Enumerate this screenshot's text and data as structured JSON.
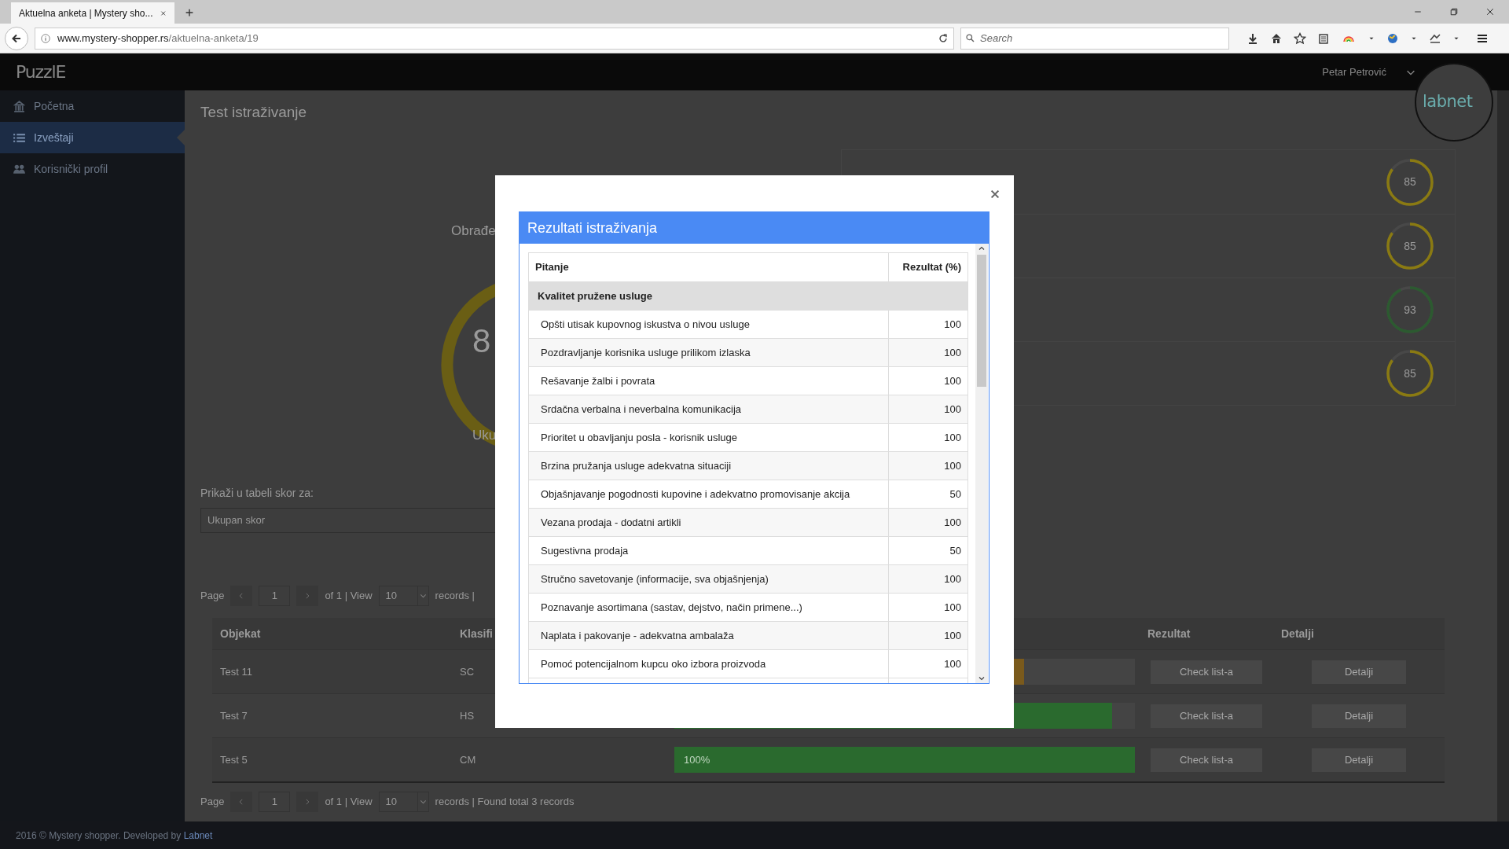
{
  "browser": {
    "tab_title": "Aktuelna anketa | Mystery sho...",
    "url_domain": "www.mystery-shopper.rs",
    "url_path": "/aktuelna-anketa/19",
    "search": {
      "placeholder": "Search"
    }
  },
  "header": {
    "logo": "PuzzlE",
    "user": "Petar Petrović",
    "brand_logo": "labnet"
  },
  "sidebar": {
    "items": [
      {
        "label": "Početna",
        "selected": false
      },
      {
        "label": "Izveštaji",
        "selected": true
      },
      {
        "label": "Korisnički profil",
        "selected": false
      }
    ]
  },
  "page": {
    "title": "Test istraživanje",
    "summary": {
      "label": "Obrađe",
      "value": "8",
      "caption": "Uku"
    },
    "score_cards": [
      {
        "score": "85",
        "level": 0.85,
        "color": "#8a7a12"
      },
      {
        "score": "85",
        "level": 0.85,
        "color": "#8a7a12"
      },
      {
        "score": "93",
        "level": 0.93,
        "color": "#2c5a30"
      },
      {
        "score": "85",
        "level": 0.85,
        "color": "#8a7a12"
      }
    ],
    "filter": {
      "label": "Prikaži u tabeli skor za:",
      "value": "Ukupan skor"
    },
    "pager_top": {
      "page_label": "Page",
      "page": "1",
      "of": "of 1 | View",
      "per_page": "10",
      "records": "records |"
    },
    "table": {
      "columns": [
        "Objekat",
        "Klasifi",
        "Rezultat",
        "Detalji"
      ],
      "rows": [
        {
          "objekat": "Test 11",
          "klasifikacija": "SC",
          "level": 0.76,
          "color": "#7a5a1c",
          "checklist": "Check list-a",
          "details": "Detalji"
        },
        {
          "objekat": "Test 7",
          "klasifikacija": "HS",
          "level": 0.95,
          "color": "#2a6a2e",
          "checklist": "Check list-a",
          "details": "Detalji"
        },
        {
          "objekat": "Test 5",
          "klasifikacija": "CM",
          "level": 1,
          "color": "#2a6a2e",
          "bar_label": "100%",
          "checklist": "Check list-a",
          "details": "Detalji"
        }
      ]
    },
    "pager_bottom": {
      "page_label": "Page",
      "page": "1",
      "of": "of 1 | View",
      "per_page": "10",
      "records": "records | Found total 3 records"
    }
  },
  "footer": {
    "text": "2016 © Mystery shopper. Developed by",
    "link": "Labnet"
  },
  "modal": {
    "title": "Rezultati istraživanja",
    "columns": [
      "Pitanje",
      "Rezultat (%)"
    ],
    "section": "Kvalitet pružene usluge",
    "rows": [
      {
        "question": "Opšti utisak kupovnog iskustva o nivou usluge",
        "result": "100"
      },
      {
        "question": "Pozdravljanje korisnika usluge prilikom izlaska",
        "result": "100"
      },
      {
        "question": "Rešavanje žalbi i povrata",
        "result": "100"
      },
      {
        "question": "Srdačna verbalna i neverbalna komunikacija",
        "result": "100"
      },
      {
        "question": "Prioritet u obavljanju posla - korisnik usluge",
        "result": "100"
      },
      {
        "question": "Brzina pružanja usluge adekvatna situaciji",
        "result": "100"
      },
      {
        "question": "Objašnjavanje pogodnosti kupovine i adekvatno promovisanje akcija",
        "result": "50"
      },
      {
        "question": "Vezana prodaja - dodatni artikli",
        "result": "100"
      },
      {
        "question": "Sugestivna prodaja",
        "result": "50"
      },
      {
        "question": "Stručno savetovanje (informacije, sva objašnjenja)",
        "result": "100"
      },
      {
        "question": "Poznavanje asortimana (sastav, dejstvo, način primene...)",
        "result": "100"
      },
      {
        "question": "Naplata i pakovanje - adekvatna ambalaža",
        "result": "100"
      },
      {
        "question": "Pomoć potencijalnom kupcu oko izbora proizvoda",
        "result": "100"
      }
    ]
  }
}
